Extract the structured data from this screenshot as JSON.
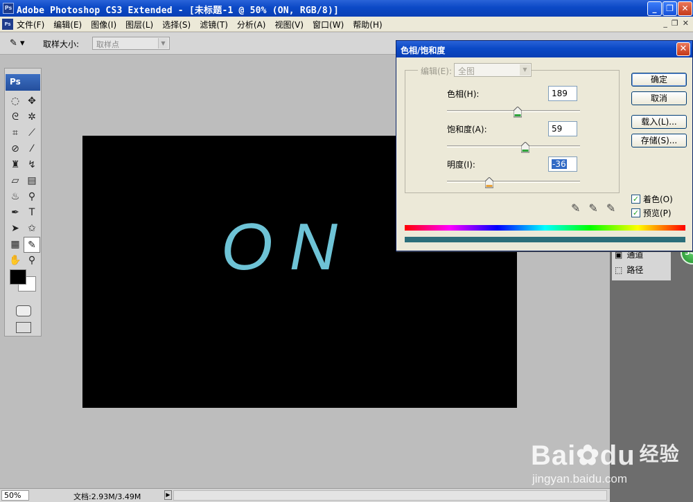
{
  "window": {
    "logo": "Ps",
    "title": "Adobe Photoshop CS3 Extended - [未标题-1 @ 50% (ON, RGB/8)]",
    "min_label": "_",
    "max_label": "❐",
    "close_label": "✕"
  },
  "menubar": {
    "doc_icon": "Ps",
    "items": [
      "文件(F)",
      "编辑(E)",
      "图像(I)",
      "图层(L)",
      "选择(S)",
      "滤镜(T)",
      "分析(A)",
      "视图(V)",
      "窗口(W)",
      "帮助(H)"
    ],
    "mdi": [
      "_",
      "❐",
      "✕"
    ]
  },
  "options": {
    "tool_icon": "eyedropper-icon",
    "sample_size_label": "取样大小:",
    "sample_size_value": "取样点"
  },
  "toolbox": {
    "header": "Ps",
    "tools": [
      "marquee",
      "move",
      "lasso",
      "magic-wand",
      "crop",
      "slice",
      "healing",
      "brush",
      "stamp",
      "history-brush",
      "eraser",
      "gradient",
      "blur",
      "dodge",
      "pen",
      "type",
      "path-select",
      "shape",
      "notes",
      "eyedropper",
      "hand",
      "zoom"
    ],
    "active_tool": "eyedropper",
    "foreground_color": "#000000",
    "background_color": "#ffffff"
  },
  "canvas": {
    "text": "ON",
    "text_color": "#6ec3d6",
    "background": "#000000"
  },
  "dialog": {
    "title": "色相/饱和度",
    "edit_label": "编辑(E):",
    "edit_value": "全图",
    "hue_label": "色相(H):",
    "hue_value": "189",
    "hue_fraction": 0.53,
    "saturation_label": "饱和度(A):",
    "saturation_value": "59",
    "saturation_fraction": 0.59,
    "lightness_label": "明度(I):",
    "lightness_value": "-36",
    "lightness_fraction": 0.32,
    "buttons": [
      "确定",
      "取消",
      "载入(L)...",
      "存储(S)..."
    ],
    "colorize_label": "着色(O)",
    "colorize_checked": true,
    "preview_label": "预览(P)",
    "preview_checked": true,
    "spectrum_bottom_color": "#2b6e7a"
  },
  "panels": {
    "items": [
      "通道",
      "路径"
    ],
    "badge": "54"
  },
  "status": {
    "zoom": "50%",
    "doc": "文档:2.93M/3.49M"
  },
  "watermark": {
    "brand": "Bai",
    "brand2": "du",
    "brand_cn": "经验",
    "url": "jingyan.baidu.com"
  }
}
